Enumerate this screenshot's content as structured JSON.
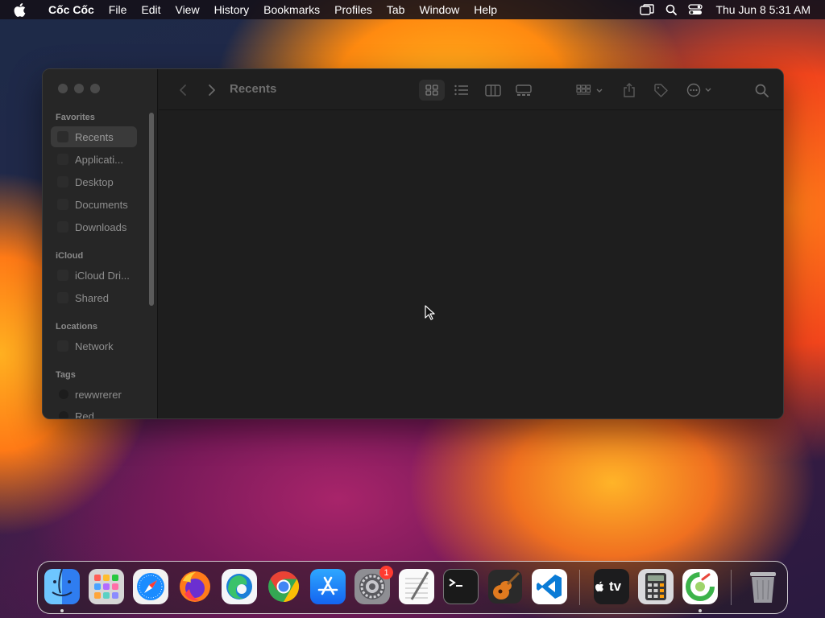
{
  "menubar": {
    "app_name": "Cốc Cốc",
    "items": [
      "File",
      "Edit",
      "View",
      "History",
      "Bookmarks",
      "Profiles",
      "Tab",
      "Window",
      "Help"
    ],
    "clock": "Thu Jun 8  5:31 AM"
  },
  "finder": {
    "title": "Recents",
    "sidebar": {
      "favorites_title": "Favorites",
      "favorites": [
        "Recents",
        "Applicati...",
        "Desktop",
        "Documents",
        "Downloads"
      ],
      "icloud_title": "iCloud",
      "icloud": [
        "iCloud Dri...",
        "Shared"
      ],
      "locations_title": "Locations",
      "locations": [
        "Network"
      ],
      "tags_title": "Tags",
      "tags": [
        "rewwrerer",
        "Red"
      ]
    }
  },
  "dock": {
    "apps": [
      "Finder",
      "Launchpad",
      "Safari",
      "Firefox",
      "Microsoft Edge",
      "Google Chrome",
      "App Store",
      "System Settings",
      "TextEdit",
      "Terminal",
      "GarageBand",
      "Visual Studio Code",
      "Apple TV",
      "Calculator",
      "Cốc Cốc",
      "Trash"
    ],
    "settings_badge": "1",
    "tv_label": "tv"
  },
  "colors": {
    "finder_blue": "#1d7bf1",
    "badge_red": "#ff3b30"
  }
}
